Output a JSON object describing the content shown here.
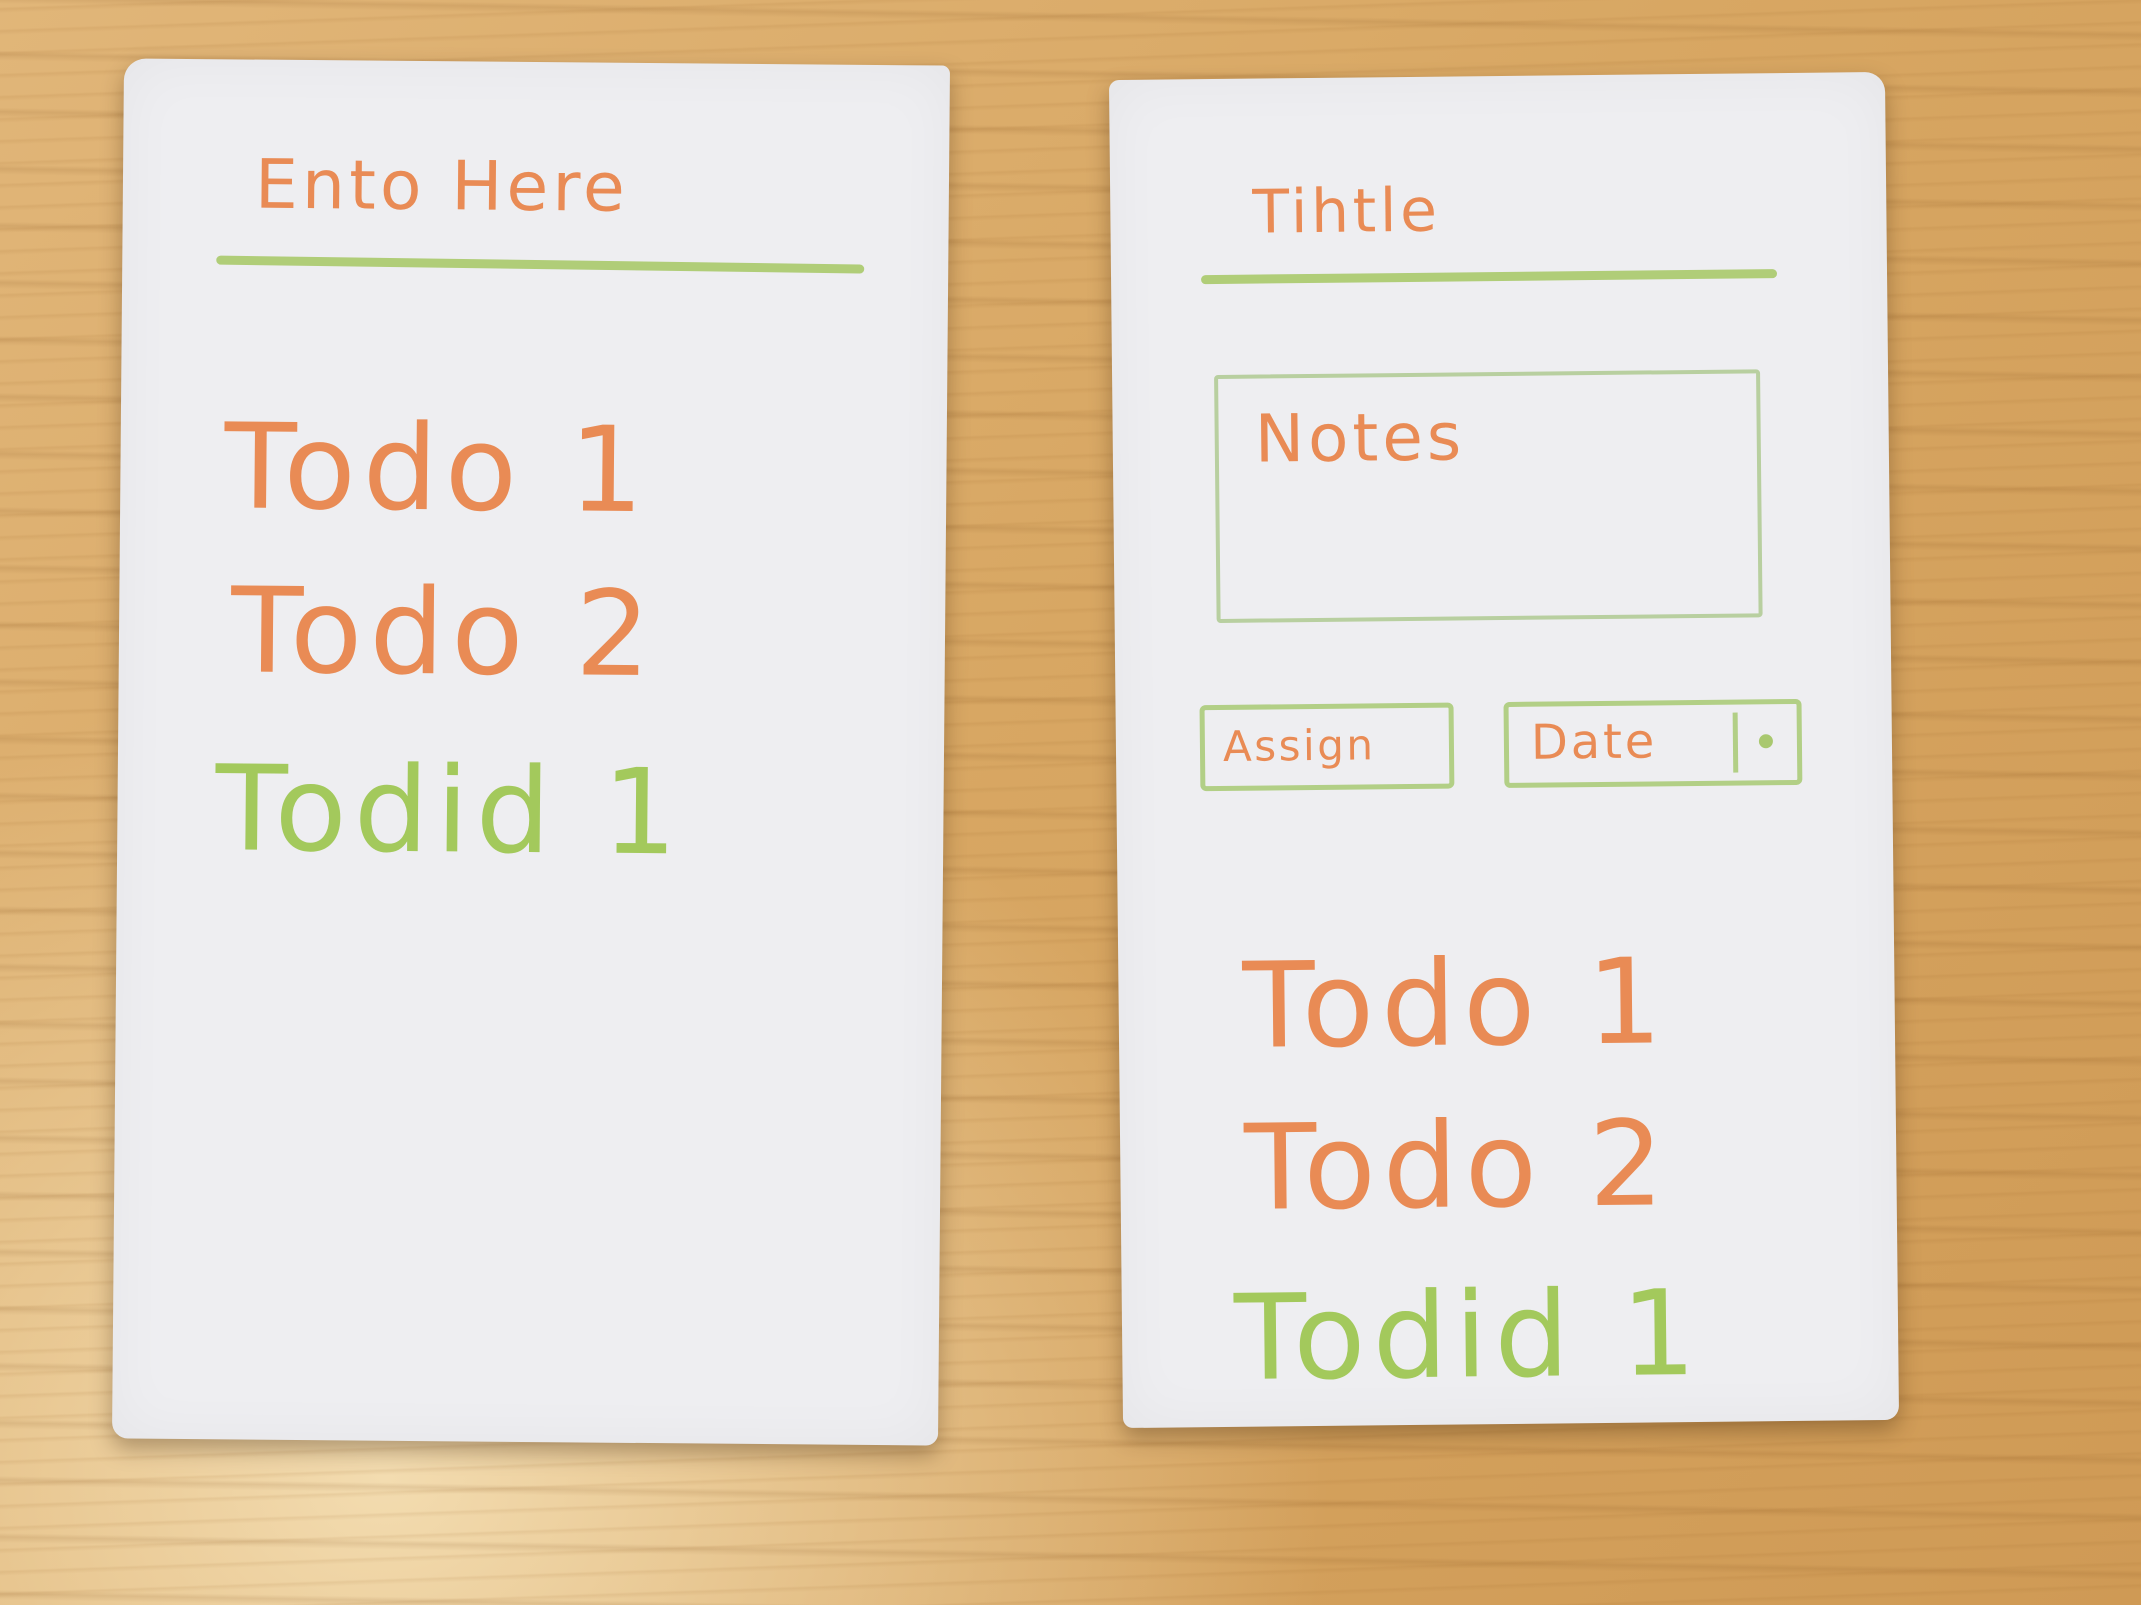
{
  "left_screen": {
    "input_label": "Ento Here",
    "todos": [
      "Todo 1",
      "Todo 2"
    ],
    "done": [
      "Todid 1"
    ]
  },
  "right_screen": {
    "title": "Tihtle",
    "notes_label": "Notes",
    "assign_label": "Assign",
    "date_label": "Date",
    "todos": [
      "Todo 1",
      "Todo 2"
    ],
    "done": [
      "Todid 1"
    ]
  },
  "colors": {
    "pending": "#e98b55",
    "done": "#a3c95c",
    "rule": "#a8c96a"
  }
}
